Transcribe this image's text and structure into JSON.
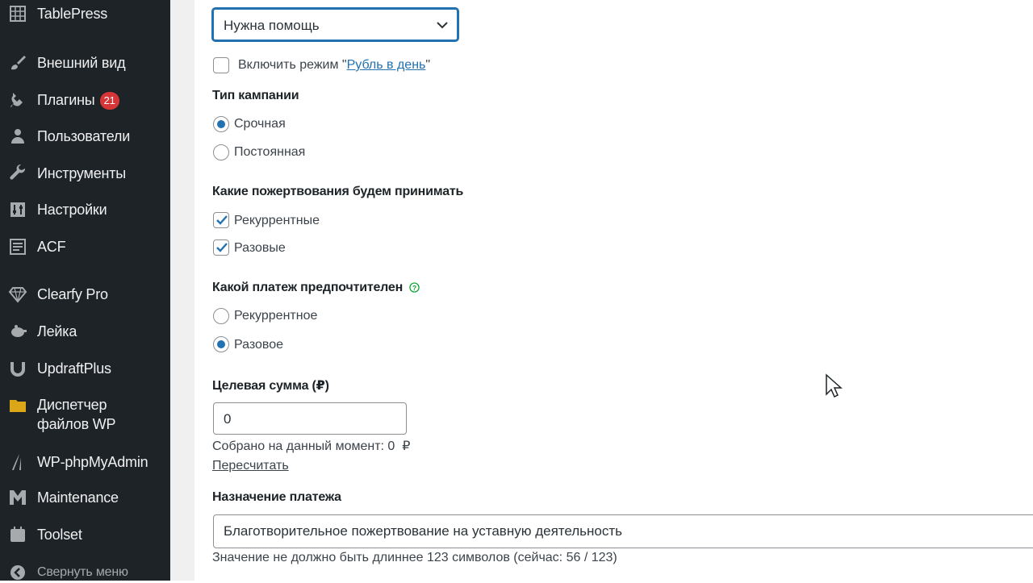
{
  "sidebar": {
    "items": [
      {
        "label": "TablePress",
        "icon": "tablepress-icon"
      },
      {
        "label": "Внешний вид",
        "icon": "appearance-brush-icon"
      },
      {
        "label": "Плагины",
        "icon": "plugins-icon",
        "badge": "21"
      },
      {
        "label": "Пользователи",
        "icon": "users-icon"
      },
      {
        "label": "Инструменты",
        "icon": "tools-wrench-icon"
      },
      {
        "label": "Настройки",
        "icon": "settings-icon"
      },
      {
        "label": "ACF",
        "icon": "acf-icon"
      },
      {
        "label": "Clearfy Pro",
        "icon": "diamond-icon"
      },
      {
        "label": "Лейка",
        "icon": "leyka-icon"
      },
      {
        "label": "UpdraftPlus",
        "icon": "updraft-icon"
      },
      {
        "label": "Диспетчер файлов WP",
        "line1": "Диспетчер",
        "line2": "файлов WP",
        "icon": "folder-icon"
      },
      {
        "label": "WP-phpMyAdmin",
        "icon": "phpmyadmin-icon"
      },
      {
        "label": "Maintenance",
        "icon": "maintenance-icon"
      },
      {
        "label": "Toolset",
        "icon": "toolset-icon"
      }
    ],
    "collapse_label": "Свернуть меню"
  },
  "form": {
    "select_value": "Нужна помощь",
    "rubl_checkbox": {
      "prefix": "Включить режим \"",
      "link": "Рубль в день",
      "suffix": "\"",
      "checked": false
    },
    "campaign_type": {
      "label": "Тип кампании",
      "options": [
        {
          "label": "Срочная",
          "checked": true
        },
        {
          "label": "Постоянная",
          "checked": false
        }
      ]
    },
    "donations_accepted": {
      "label": "Какие пожертвования будем принимать",
      "options": [
        {
          "label": "Рекуррентные",
          "checked": true
        },
        {
          "label": "Разовые",
          "checked": true
        }
      ]
    },
    "preferred_payment": {
      "label": "Какой платеж предпочтителен",
      "options": [
        {
          "label": "Рекуррентное",
          "checked": false
        },
        {
          "label": "Разовое",
          "checked": true
        }
      ]
    },
    "target_sum": {
      "label": "Целевая сумма (₽)",
      "value": "0",
      "collected_text": "Собрано на данный момент: 0  ₽",
      "recalc_link": "Пересчитать"
    },
    "payment_purpose": {
      "label": "Назначение платежа",
      "value": "Благотворительное пожертвование на уставную деятельность",
      "hint": "Значение не должно быть длиннее 123 символов (сейчас: 56 / 123)"
    }
  },
  "colors": {
    "sidebar_bg": "#1d2327",
    "accent": "#2271b1",
    "badge": "#d63638"
  }
}
